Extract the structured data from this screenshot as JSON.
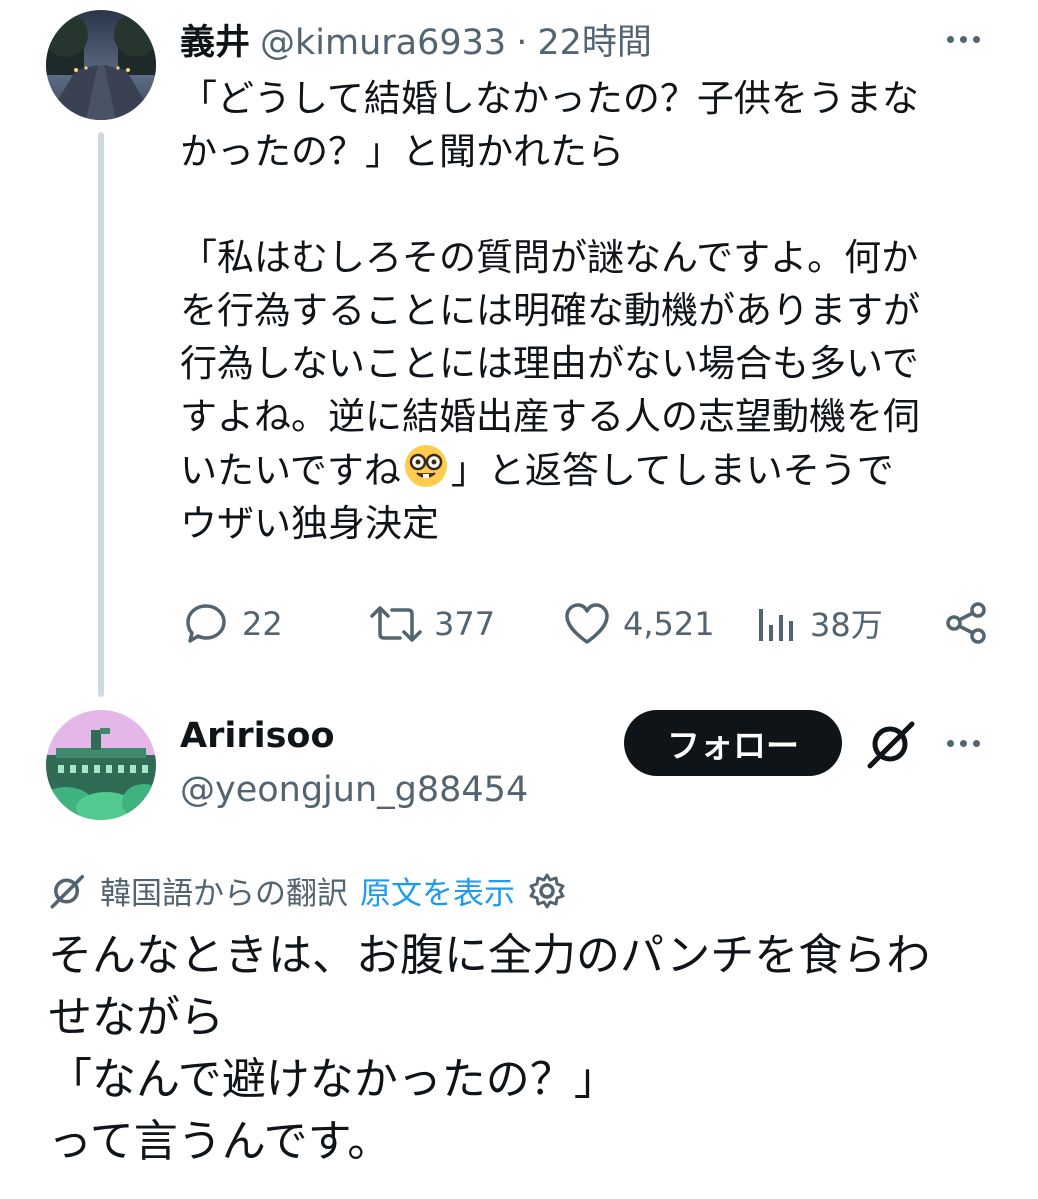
{
  "tweet1": {
    "name": "義井",
    "handle": "@kimura6933",
    "separator": "·",
    "time": "22時間",
    "body_part1": "「どうして結婚しなかったの？子供をうまな\nかったの？」と聞かれたら\n\n「私はむしろその質問が謎なんですよ。何か\nを行為することには明確な動機がありますが\n行為しないことには理由がない場合も多いで\nすよね。逆に結婚出産する人の志望動機を伺\nいたいですね",
    "body_emoji": "nerd-face-emoji",
    "body_part2": "」と返答してしまいそうで\nウザい独身決定",
    "replies": "22",
    "retweets": "377",
    "likes": "4,521",
    "views": "38万"
  },
  "tweet2": {
    "name": "Aririsoo",
    "handle": "@yeongjun_g88454",
    "follow_label": "フォロー",
    "translation_label": "韓国語からの翻訳",
    "show_original": "原文を表示",
    "body": "そんなときは、お腹に全力のパンチを食らわ\nせながら\n「なんで避けなかったの？」\nって言うんです。"
  },
  "icons": [
    "more-icon",
    "reply-icon",
    "retweet-icon",
    "like-icon",
    "views-icon",
    "share-icon",
    "grok-icon",
    "translate-icon",
    "settings-icon"
  ],
  "colors": {
    "text": "#0f1419",
    "muted": "#536471",
    "link": "#1d9bf0",
    "line": "#cfd9de"
  }
}
